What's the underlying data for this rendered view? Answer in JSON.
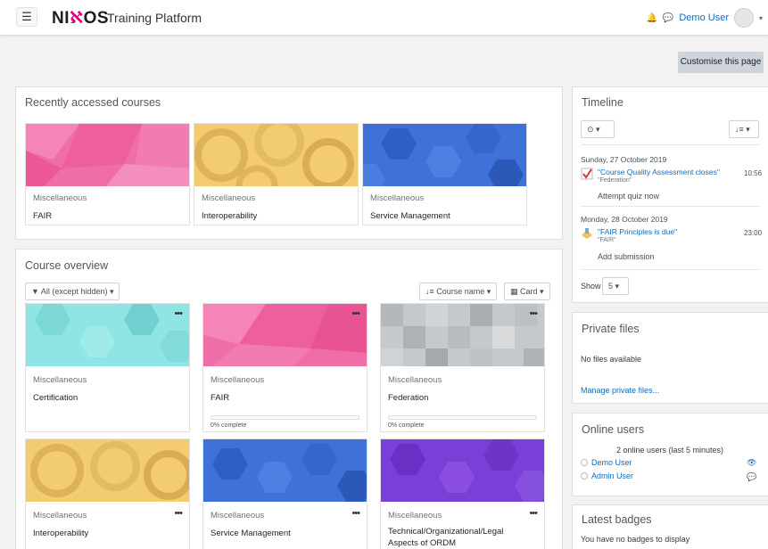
{
  "header": {
    "menu_icon": "☰",
    "logo": {
      "left": "NI",
      "swoosh": "ℵ",
      "right": "OS"
    },
    "platform_name": "Training Platform",
    "bell_icon": "🔔",
    "chat_icon": "💬",
    "user_name": "Demo User",
    "user_caret": "▾"
  },
  "customise_label": "Customise this page",
  "recent": {
    "title": "Recently accessed courses",
    "courses": [
      {
        "category": "Miscellaneous",
        "name": "FAIR",
        "theme": "pink"
      },
      {
        "category": "Miscellaneous",
        "name": "Interoperability",
        "theme": "yellow"
      },
      {
        "category": "Miscellaneous",
        "name": "Service Management",
        "theme": "blue"
      }
    ]
  },
  "overview": {
    "title": "Course overview",
    "filter_label": "▼ All (except hidden) ▾",
    "sort_label": "↓≡ Course name ▾",
    "view_label": "▦ Card ▾",
    "menu_dots": "•••",
    "courses": [
      {
        "category": "Miscellaneous",
        "name": "Certification",
        "theme": "cyan",
        "progress": ""
      },
      {
        "category": "Miscellaneous",
        "name": "FAIR",
        "theme": "pink",
        "progress": "0% complete"
      },
      {
        "category": "Miscellaneous",
        "name": "Federation",
        "theme": "grey",
        "progress": "0% complete"
      },
      {
        "category": "Miscellaneous",
        "name": "Interoperability",
        "theme": "yellow",
        "progress": ""
      },
      {
        "category": "Miscellaneous",
        "name": "Service Management",
        "theme": "blue",
        "progress": ""
      },
      {
        "category": "Miscellaneous",
        "name": "Technical/Organizational/Legal Aspects of ORDM",
        "theme": "purple",
        "progress": ""
      }
    ]
  },
  "timeline": {
    "title": "Timeline",
    "filter_button": "⊙ ▾",
    "sort_button": "↓≡ ▾",
    "days": [
      {
        "date": "Sunday, 27 October 2019",
        "event": "\"Course Quality Assessment closes\"",
        "course": "\"Federation\"",
        "time": "10:56",
        "action": "Attempt quiz now",
        "icon": "quiz-icon"
      },
      {
        "date": "Monday, 28 October 2019",
        "event": "\"FAIR Principles is due\"",
        "course": "\"FAIR\"",
        "time": "23:00",
        "action": "Add submission",
        "icon": "assignment-icon"
      }
    ],
    "show_label": "Show",
    "show_value": "5 ▾"
  },
  "private_files": {
    "title": "Private files",
    "empty_text": "No files available",
    "manage_link": "Manage private files..."
  },
  "online_users": {
    "title": "Online users",
    "summary": "2 online users (last 5 minutes)",
    "users": [
      "Demo User",
      "Admin User"
    ],
    "eye_icon": "👁",
    "message_icon": "💬"
  },
  "badges": {
    "title": "Latest badges",
    "empty_text": "You have no badges to display"
  }
}
